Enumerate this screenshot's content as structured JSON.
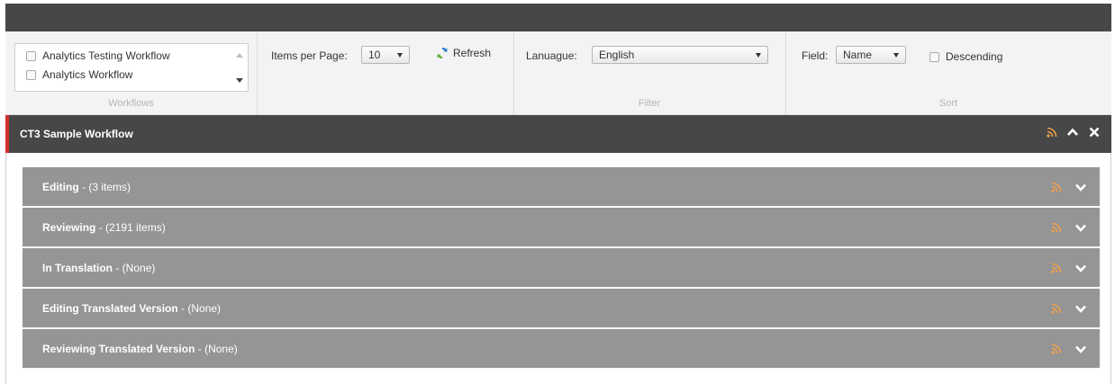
{
  "workflows": {
    "items": [
      {
        "label": "Analytics Testing Workflow"
      },
      {
        "label": "Analytics Workflow"
      }
    ],
    "caption": "Workflows"
  },
  "paging": {
    "items_per_page_label": "Items per Page:",
    "items_per_page_value": "10",
    "refresh_label": "Refresh"
  },
  "filter": {
    "language_label": "Lanuague:",
    "language_value": "English",
    "caption": "Filter"
  },
  "sort": {
    "field_label": "Field:",
    "field_value": "Name",
    "descending_label": "Descending",
    "caption": "Sort"
  },
  "panel": {
    "title": "CT3 Sample Workflow"
  },
  "states": [
    {
      "name": "Editing",
      "count": " - (3 items)"
    },
    {
      "name": "Reviewing",
      "count": " - (2191 items)"
    },
    {
      "name": "In Translation",
      "count": " - (None)"
    },
    {
      "name": "Editing Translated Version",
      "count": " - (None)"
    },
    {
      "name": "Reviewing Translated Version",
      "count": " - (None)"
    }
  ],
  "colors": {
    "header_bg": "#474747",
    "accent": "#d3302f",
    "rss": "#f0a04b",
    "row_bg": "#959595"
  }
}
